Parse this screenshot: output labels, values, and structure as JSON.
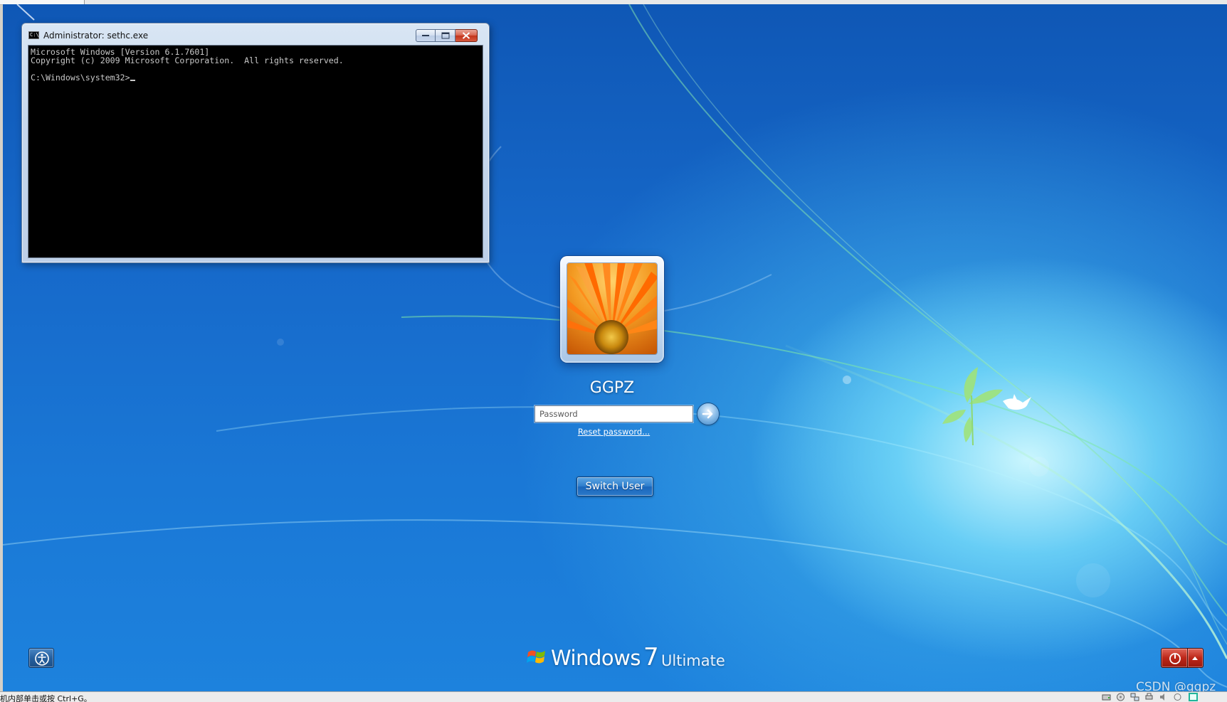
{
  "cmd_window": {
    "title": "Administrator: sethc.exe",
    "console_lines": "Microsoft Windows [Version 6.1.7601]\nCopyright (c) 2009 Microsoft Corporation.  All rights reserved.\n\nC:\\Windows\\system32>"
  },
  "logon": {
    "username": "GGPZ",
    "password_placeholder": "Password",
    "reset_password_label": "Reset password...",
    "switch_user_label": "Switch User"
  },
  "branding": {
    "windows": "Windows",
    "version": "7",
    "edition": "Ultimate"
  },
  "vm_status": {
    "hint_text": "机内部单击或按 Ctrl+G。"
  },
  "watermark": "CSDN @ggpz",
  "colors": {
    "desktop_blue": "#1668c9",
    "console_bg": "#000000",
    "shutdown_red": "#bd2718"
  },
  "icons": [
    "cmd-icon",
    "minimize-icon",
    "maximize-icon",
    "close-icon",
    "arrow-right-icon",
    "ease-of-access-icon",
    "windows-flag-icon",
    "power-icon",
    "chevron-up-icon"
  ]
}
